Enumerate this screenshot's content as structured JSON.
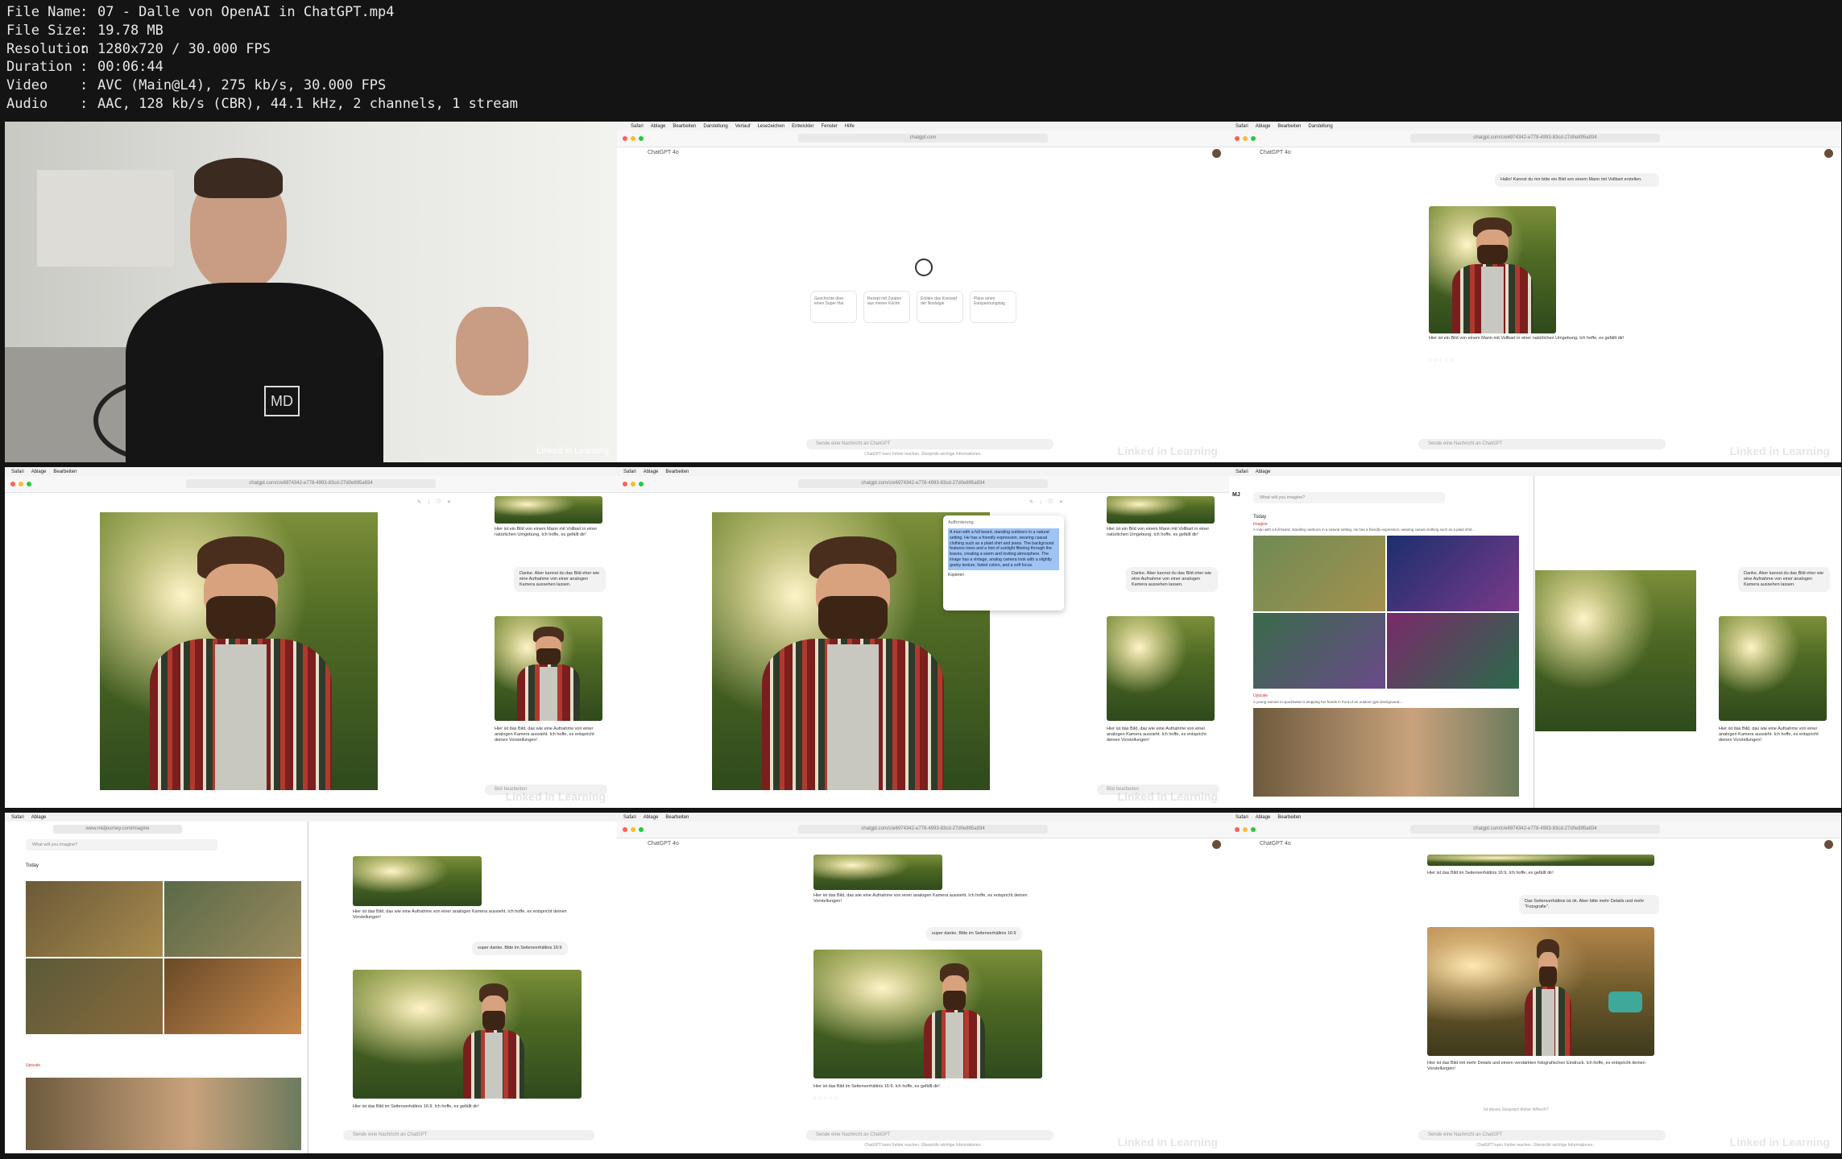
{
  "meta": {
    "rows": [
      {
        "key": "File Name",
        "value": "07 - Dalle von OpenAI in ChatGPT.mp4"
      },
      {
        "key": "File Size",
        "value": "19.78 MB"
      },
      {
        "key": "Resolution",
        "value": "1280x720 / 30.000 FPS"
      },
      {
        "key": "Duration",
        "value": "00:06:44"
      },
      {
        "key": "Video",
        "value": "AVC (Main@L4), 275 kb/s, 30.000 FPS"
      },
      {
        "key": "Audio",
        "value": "AAC, 128 kb/s (CBR), 44.1 kHz, 2 channels, 1 stream"
      }
    ]
  },
  "common": {
    "model": "ChatGPT 4o",
    "composer_placeholder": "Sende eine Nachricht an ChatGPT",
    "footer": "ChatGPT kann Fehler machen. Überprüfe wichtige Informationen.",
    "watermark": "Linked in Learning",
    "url_chat": "chatgpt.com/c/e6974342-e778-4993-83cd-27d0e895a934",
    "url_home": "chatgpt.com",
    "url_mj": "www.midjourney.com/imagine",
    "menu": [
      "Safari",
      "Ablage",
      "Bearbeiten",
      "Darstellung",
      "Verlauf",
      "Lesezeichen",
      "Entwickler",
      "Fenster",
      "Hilfe"
    ]
  },
  "thumb1": {
    "shirt_logo": "MD",
    "brand": "Linked in Learning"
  },
  "thumb2": {
    "cards": [
      "Geschichte über einen Super-Hai",
      "Rezept mit Zutaten aus meiner Küche",
      "Erkläre das Konzept der Nostalgie",
      "Plane einen Entspannungstag"
    ]
  },
  "thumb3": {
    "user_msg": "Hallo! Kannst du mir bitte ein Bild von einem Mann mit Vollbart erstellen.",
    "reply": "Hier ist ein Bild von einem Mann mit Vollbart in einer natürlichen Umgebung. Ich hoffe, es gefällt dir!"
  },
  "thumb4": {
    "reply1": "Hier ist ein Bild von einem Mann mit Vollbart in einer natürlichen Umgebung. Ich hoffe, es gefällt dir!",
    "user_msg": "Danke. Aber kannst du das Bild eher wie eine Aufnahme von einer analogen Kamera aussehen lassen.",
    "reply2": "Hier ist das Bild, das wie eine Aufnahme von einer analogen Kamera aussieht. Ich hoffe, es entspricht deinen Vorstellungen!",
    "composer": "Bild bearbeiten"
  },
  "thumb5": {
    "popup_title": "Aufforderung",
    "popup_text": "A man with a full beard, standing outdoors in a natural setting. He has a friendly expression, wearing casual clothing such as a plaid shirt and jeans. The background features trees and a hint of sunlight filtering through the leaves, creating a warm and inviting atmosphere. The image has a vintage, analog camera look with a slightly grainy texture, faded colors, and a soft focus.",
    "copy": "Kopieren"
  },
  "thumb6": {
    "search": "What will you imagine?",
    "today": "Today",
    "label": "Imagine",
    "prompt": "A man with a full beard, standing outdoors in a natural setting. He has a friendly expression, wearing casual clothing such as a plaid shirt...",
    "upscale": "Upscale",
    "prompt2": "A young woman in sportswear is stopping her hands in front of an outdoor gym background..."
  },
  "thumb7": {
    "reply1": "Hier ist das Bild, das wie eine Aufnahme von einer analogen Kamera aussieht. Ich hoffe, es entspricht deinen Vorstellungen!",
    "user_msg": "super danke. Bitte im Seitenverhältnis 16:9",
    "reply2": "Hier ist das Bild im Seitenverhältnis 16:9. Ich hoffe, es gefällt dir!"
  },
  "thumb9": {
    "reply_top": "Hier ist das Bild im Seitenverhältnis 16:9. Ich hoffe, es gefällt dir!",
    "user_msg": "Das Seitenverhältnis ist ok. Aber bitte mehr Details und mehr \"Fotografie\".",
    "reply": "Hier ist das Bild mit mehr Details und einem verstärkten fotografischen Eindruck. Ich hoffe, es entspricht deinen Vorstellungen!",
    "note": "Ist dieses Gespräch bisher hilfreich?"
  }
}
